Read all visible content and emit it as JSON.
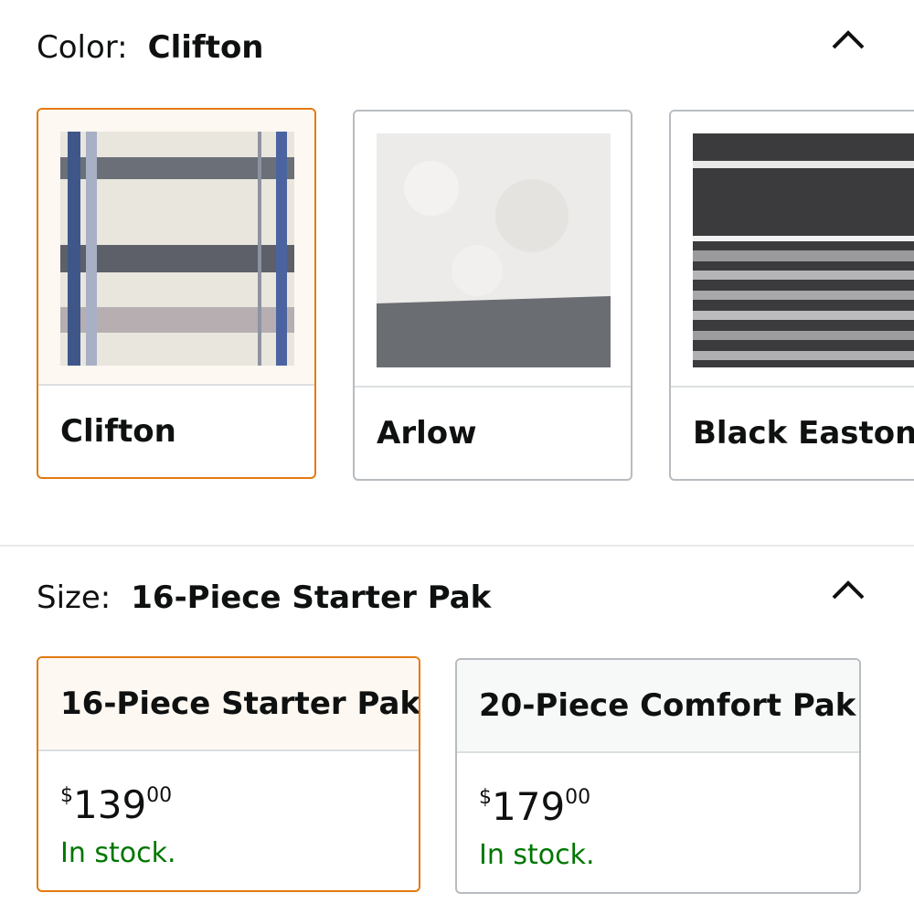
{
  "color_section": {
    "label": "Color:",
    "selected_value": "Clifton",
    "collapse_icon": "chevron-up-icon",
    "swatches": [
      {
        "name": "Clifton",
        "selected": true,
        "pattern": "clifton-plaid"
      },
      {
        "name": "Arlow",
        "selected": false,
        "pattern": "arlow-sherpa"
      },
      {
        "name": "Black Easton",
        "selected": false,
        "pattern": "black-easton-stripe"
      }
    ]
  },
  "size_section": {
    "label": "Size:",
    "selected_value": "16-Piece Starter Pak",
    "collapse_icon": "chevron-up-icon",
    "options": [
      {
        "title": "16-Piece Starter Pak",
        "currency": "$",
        "price_whole": "139",
        "price_fraction": "00",
        "stock": "In stock.",
        "selected": true
      },
      {
        "title": "20-Piece Comfort Pak",
        "currency": "$",
        "price_whole": "179",
        "price_fraction": "00",
        "stock": "In stock.",
        "selected": false
      }
    ]
  },
  "colors": {
    "selected_border": "#e47911",
    "in_stock": "#007600",
    "text": "#0f1111"
  }
}
